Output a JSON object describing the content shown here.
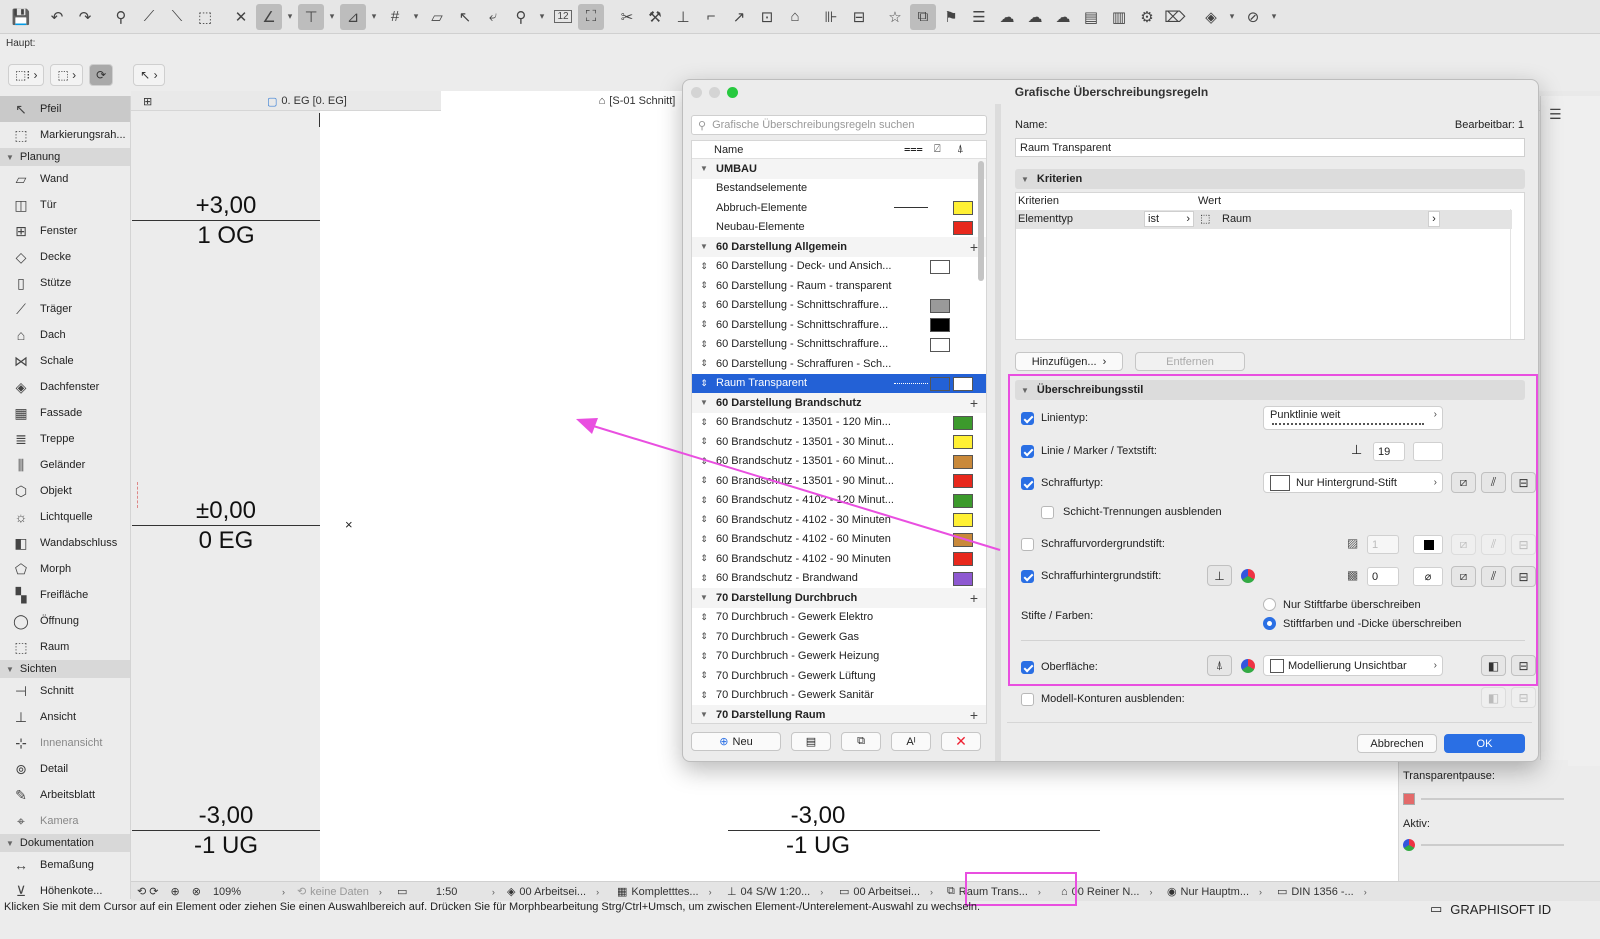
{
  "toolbar": {
    "icons": [
      "save-icon",
      "undo-icon",
      "redo-icon",
      "magic-wand-icon",
      "eyedropper-icon",
      "syringe-icon",
      "transform-icon",
      "snap-icon",
      "angle-guide-icon",
      "guide-line-icon",
      "guide-icon",
      "grid-icon",
      "layers-icon",
      "cursor-icon",
      "pointer-icon",
      "pin-icon",
      "number-icon",
      "fit-icon",
      "trim-icon",
      "hammer-icon",
      "elevate-icon",
      "curve-icon",
      "offset-icon",
      "split-icon",
      "merge-icon",
      "dimension-icon",
      "spread-icon",
      "star-icon",
      "override-icon",
      "flag-icon",
      "list-icon",
      "cloud-icon",
      "cloud-check-icon",
      "cloud-sync-icon",
      "report-icon",
      "book-icon",
      "settings-icon",
      "tag-icon",
      "render-icon",
      "arrow-icon"
    ],
    "grid_value": "12"
  },
  "haupt_label": "Haupt:",
  "palette": {
    "top_items": [
      {
        "label": "Pfeil",
        "icon": "↖",
        "selected": true
      },
      {
        "label": "Markierungsrah...",
        "icon": "⬚"
      }
    ],
    "groups": [
      {
        "title": "Planung",
        "items": [
          {
            "label": "Wand",
            "icon": "▱"
          },
          {
            "label": "Tür",
            "icon": "◫"
          },
          {
            "label": "Fenster",
            "icon": "⊞"
          },
          {
            "label": "Decke",
            "icon": "◇"
          },
          {
            "label": "Stütze",
            "icon": "▯"
          },
          {
            "label": "Träger",
            "icon": "⟋"
          },
          {
            "label": "Dach",
            "icon": "⌂"
          },
          {
            "label": "Schale",
            "icon": "⋈"
          },
          {
            "label": "Dachfenster",
            "icon": "◈"
          },
          {
            "label": "Fassade",
            "icon": "▦"
          },
          {
            "label": "Treppe",
            "icon": "≣"
          },
          {
            "label": "Geländer",
            "icon": "⫼"
          },
          {
            "label": "Objekt",
            "icon": "⬡"
          },
          {
            "label": "Lichtquelle",
            "icon": "☼"
          },
          {
            "label": "Wandabschluss",
            "icon": "◧"
          },
          {
            "label": "Morph",
            "icon": "⬠"
          },
          {
            "label": "Freifläche",
            "icon": "▚"
          },
          {
            "label": "Öffnung",
            "icon": "◯"
          },
          {
            "label": "Raum",
            "icon": "⬚"
          }
        ]
      },
      {
        "title": "Sichten",
        "items": [
          {
            "label": "Schnitt",
            "icon": "⊣"
          },
          {
            "label": "Ansicht",
            "icon": "⊥"
          },
          {
            "label": "Innenansicht",
            "icon": "⊹",
            "dim": true
          },
          {
            "label": "Detail",
            "icon": "⊚"
          },
          {
            "label": "Arbeitsblatt",
            "icon": "✎"
          },
          {
            "label": "Kamera",
            "icon": "⌖",
            "dim": true
          }
        ]
      },
      {
        "title": "Dokumentation",
        "items": [
          {
            "label": "Bemaßung",
            "icon": "↔"
          },
          {
            "label": "Höhenkote...",
            "icon": "⊻"
          }
        ]
      }
    ]
  },
  "tabs": {
    "floor": "0. EG [0. EG]",
    "section": "[S-01 Schnitt]"
  },
  "levels": [
    {
      "elev": "+3,00",
      "name": "1 OG"
    },
    {
      "elev": "±0,00",
      "name": "0 EG"
    },
    {
      "elev": "-3,00",
      "name": "-1 UG"
    }
  ],
  "section_levels": [
    {
      "elev": "-3,00",
      "name": "-1 UG"
    }
  ],
  "dialog": {
    "title": "Grafische Überschreibungsregeln",
    "search_placeholder": "Grafische Überschreibungsregeln suchen",
    "list_header": "Name",
    "rows": [
      {
        "type": "group",
        "name": "UMBAU",
        "plus": false
      },
      {
        "type": "item",
        "name": "Bestandselemente",
        "handle": false
      },
      {
        "type": "item",
        "name": "Abbruch-Elemente",
        "handle": false,
        "ltype": "dashdot",
        "sw2": "#fff034"
      },
      {
        "type": "item",
        "name": "Neubau-Elemente",
        "handle": false,
        "sw2": "#e8281c"
      },
      {
        "type": "group",
        "name": "60 Darstellung Allgemein",
        "plus": true
      },
      {
        "type": "item",
        "name": "60 Darstellung - Deck- und Ansich...",
        "handle": true,
        "sw1": "#ffffff"
      },
      {
        "type": "item",
        "name": "60 Darstellung - Raum - transparent",
        "handle": true
      },
      {
        "type": "item",
        "name": "60 Darstellung - Schnittschraffure...",
        "handle": true,
        "sw1": "#9a9a9a"
      },
      {
        "type": "item",
        "name": "60 Darstellung - Schnittschraffure...",
        "handle": true,
        "sw1": "#000000"
      },
      {
        "type": "item",
        "name": "60 Darstellung - Schnittschraffure...",
        "handle": true,
        "sw1": "#ffffff"
      },
      {
        "type": "item",
        "name": "60 Darstellung - Schraffuren - Sch...",
        "handle": true
      },
      {
        "type": "sel",
        "name": "Raum Transparent",
        "handle": true,
        "ltype": "dotted",
        "sw1": "#2361d6",
        "sw2": "#ffffff"
      },
      {
        "type": "group",
        "name": "60 Darstellung Brandschutz",
        "plus": true
      },
      {
        "type": "item",
        "name": "60 Brandschutz - 13501 - 120 Min...",
        "handle": true,
        "sw2": "#3c9a2c"
      },
      {
        "type": "item",
        "name": "60 Brandschutz - 13501 - 30 Minut...",
        "handle": true,
        "sw2": "#fff034"
      },
      {
        "type": "item",
        "name": "60 Brandschutz - 13501 - 60 Minut...",
        "handle": true,
        "sw2": "#c9893a"
      },
      {
        "type": "item",
        "name": "60 Brandschutz - 13501 - 90 Minut...",
        "handle": true,
        "sw2": "#e8281c"
      },
      {
        "type": "item",
        "name": "60 Brandschutz - 4102 - 120 Minut...",
        "handle": true,
        "sw2": "#3c9a2c"
      },
      {
        "type": "item",
        "name": "60 Brandschutz - 4102 - 30 Minuten",
        "handle": true,
        "sw2": "#fff034"
      },
      {
        "type": "item",
        "name": "60 Brandschutz - 4102 - 60 Minuten",
        "handle": true,
        "sw2": "#c9893a"
      },
      {
        "type": "item",
        "name": "60 Brandschutz - 4102 - 90 Minuten",
        "handle": true,
        "sw2": "#e8281c"
      },
      {
        "type": "item",
        "name": "60 Brandschutz - Brandwand",
        "handle": true,
        "sw2": "#8e59d1"
      },
      {
        "type": "group",
        "name": "70 Darstellung Durchbruch",
        "plus": true
      },
      {
        "type": "item",
        "name": "70 Durchbruch - Gewerk Elektro",
        "handle": true
      },
      {
        "type": "item",
        "name": "70 Durchbruch - Gewerk Gas",
        "handle": true
      },
      {
        "type": "item",
        "name": "70 Durchbruch - Gewerk Heizung",
        "handle": true
      },
      {
        "type": "item",
        "name": "70 Durchbruch - Gewerk Lüftung",
        "handle": true
      },
      {
        "type": "item",
        "name": "70 Durchbruch - Gewerk Sanitär",
        "handle": true
      },
      {
        "type": "group",
        "name": "70 Darstellung Raum",
        "plus": true
      }
    ],
    "buttons": {
      "new": "Neu"
    },
    "name_label": "Name:",
    "editable": "Bearbeitbar: 1",
    "name_value": "Raum Transparent",
    "criteria_title": "Kriterien",
    "crit_col1": "Kriterien",
    "crit_col2": "Wert",
    "crit_row": {
      "kriterium": "Elementtyp",
      "op": "ist",
      "wert": "Raum"
    },
    "add_button": "Hinzufügen...",
    "remove_button": "Entfernen",
    "override_title": "Überschreibungsstil",
    "linetype_label": "Linientyp:",
    "linetype_value": "Punktlinie weit",
    "pen_label": "Linie / Marker / Textstift:",
    "pen_value": "19",
    "fill_label": "Schraffurtyp:",
    "fill_value": "Nur Hintergrund-Stift",
    "hide_sep_label": "Schicht-Trennungen ausblenden",
    "fg_pen_label": "Schraffurvordergrundstift:",
    "fg_pen_value": "1",
    "bg_pen_label": "Schraffurhintergrundstift:",
    "bg_pen_value": "0",
    "pens_label": "Stifte / Farben:",
    "radio1": "Nur Stiftfarbe überschreiben",
    "radio2": "Stiftfarben und -Dicke überschreiben",
    "surface_label": "Oberfläche:",
    "surface_value": "Modellierung Unsichtbar",
    "model_contour_label": "Modell-Konturen ausblenden:",
    "cancel": "Abbrechen",
    "ok": "OK"
  },
  "statusbar": {
    "zoom": "109%",
    "nodata": "keine Daten",
    "scale": "1:50",
    "layer": "00 Arbeitsei...",
    "model": "Kompletttes...",
    "pen": "04 S/W 1:20...",
    "view": "00 Arbeitsei...",
    "override": "Raum Trans...",
    "renov": "00 Reiner N...",
    "struct": "Nur Hauptm...",
    "dim": "DIN 1356 -...",
    "hint": "Klicken Sie mit dem Cursor auf ein Element oder ziehen Sie einen Auswahlbereich auf. Drücken Sie für Morphbearbeitung Strg/Ctrl+Umsch, um zwischen Element-/Unterelement-Auswahl zu wechseln.",
    "brand": "GRAPHISOFT ID"
  },
  "rightpanel": {
    "transparent_label": "Transparentpause:",
    "active_label": "Aktiv:"
  },
  "colors": {
    "accent": "#2a6fe4",
    "selection": "#2361d6",
    "annotation": "#e94fe0"
  }
}
